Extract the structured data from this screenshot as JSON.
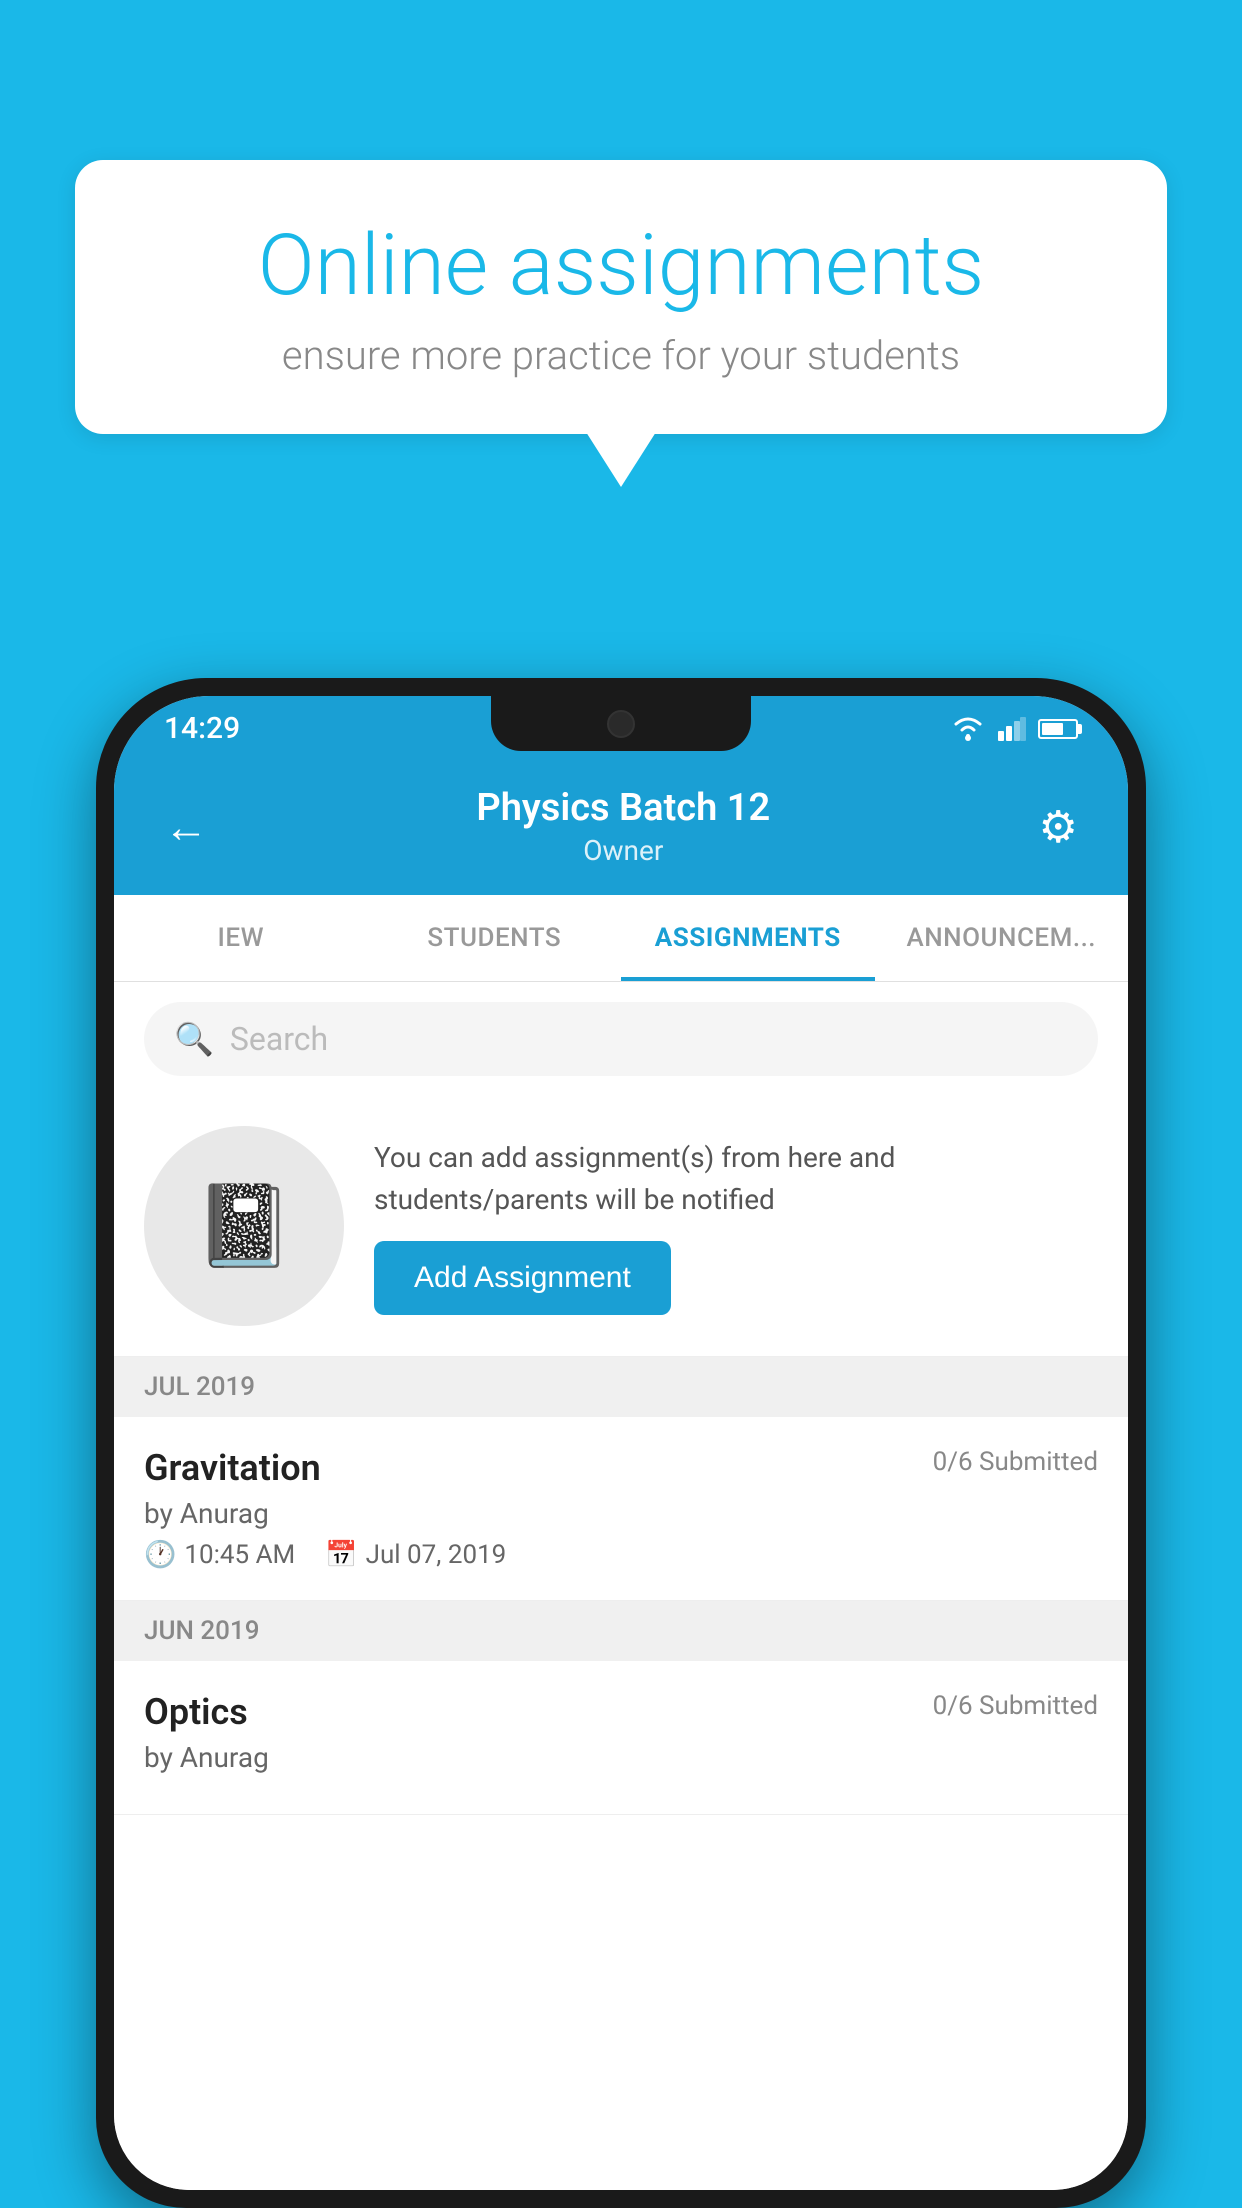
{
  "background": {
    "color": "#1ab8e8"
  },
  "speech_bubble": {
    "title": "Online assignments",
    "subtitle": "ensure more practice for your students"
  },
  "phone": {
    "status_bar": {
      "time": "14:29"
    },
    "header": {
      "title": "Physics Batch 12",
      "subtitle": "Owner",
      "back_label": "←",
      "settings_label": "⚙"
    },
    "tabs": [
      {
        "label": "IEW",
        "active": false
      },
      {
        "label": "STUDENTS",
        "active": false
      },
      {
        "label": "ASSIGNMENTS",
        "active": true
      },
      {
        "label": "ANNOUNCEM...",
        "active": false
      }
    ],
    "search": {
      "placeholder": "Search"
    },
    "promo": {
      "text": "You can add assignment(s) from here and students/parents will be notified",
      "button_label": "Add Assignment"
    },
    "assignments": [
      {
        "month": "JUL 2019",
        "items": [
          {
            "name": "Gravitation",
            "submitted": "0/6 Submitted",
            "by": "by Anurag",
            "time": "10:45 AM",
            "date": "Jul 07, 2019"
          }
        ]
      },
      {
        "month": "JUN 2019",
        "items": [
          {
            "name": "Optics",
            "submitted": "0/6 Submitted",
            "by": "by Anurag",
            "time": "",
            "date": ""
          }
        ]
      }
    ]
  }
}
